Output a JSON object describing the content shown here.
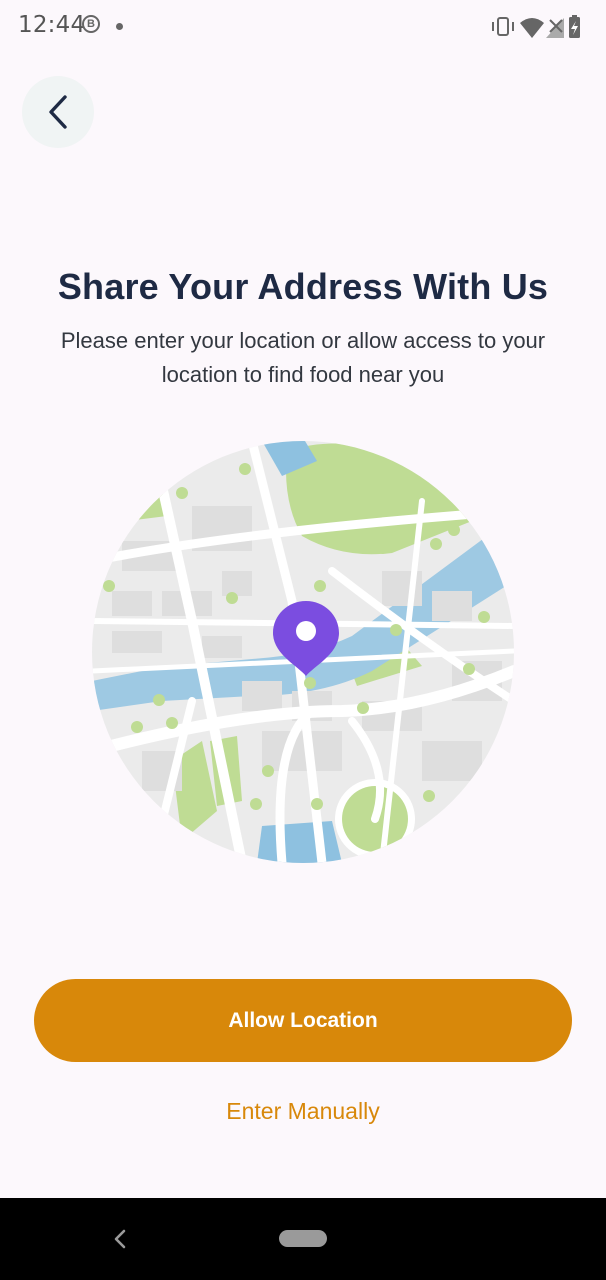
{
  "status_bar": {
    "time": "12:44",
    "badge": "B",
    "icons": [
      "vibrate-icon",
      "wifi-icon",
      "signal-icon",
      "battery-charging-icon"
    ]
  },
  "header": {
    "back_icon": "chevron-left-icon"
  },
  "content": {
    "title": "Share Your Address With Us",
    "subtitle": "Please enter your location or allow access to your location to find food near you",
    "illustration": "map-with-location-pin",
    "pin_color": "#7b4de0"
  },
  "actions": {
    "allow_label": "Allow Location",
    "manual_label": "Enter Manually",
    "accent_color": "#d8880a"
  },
  "nav_bar": {
    "icons": [
      "nav-back-icon",
      "nav-home-pill"
    ]
  }
}
